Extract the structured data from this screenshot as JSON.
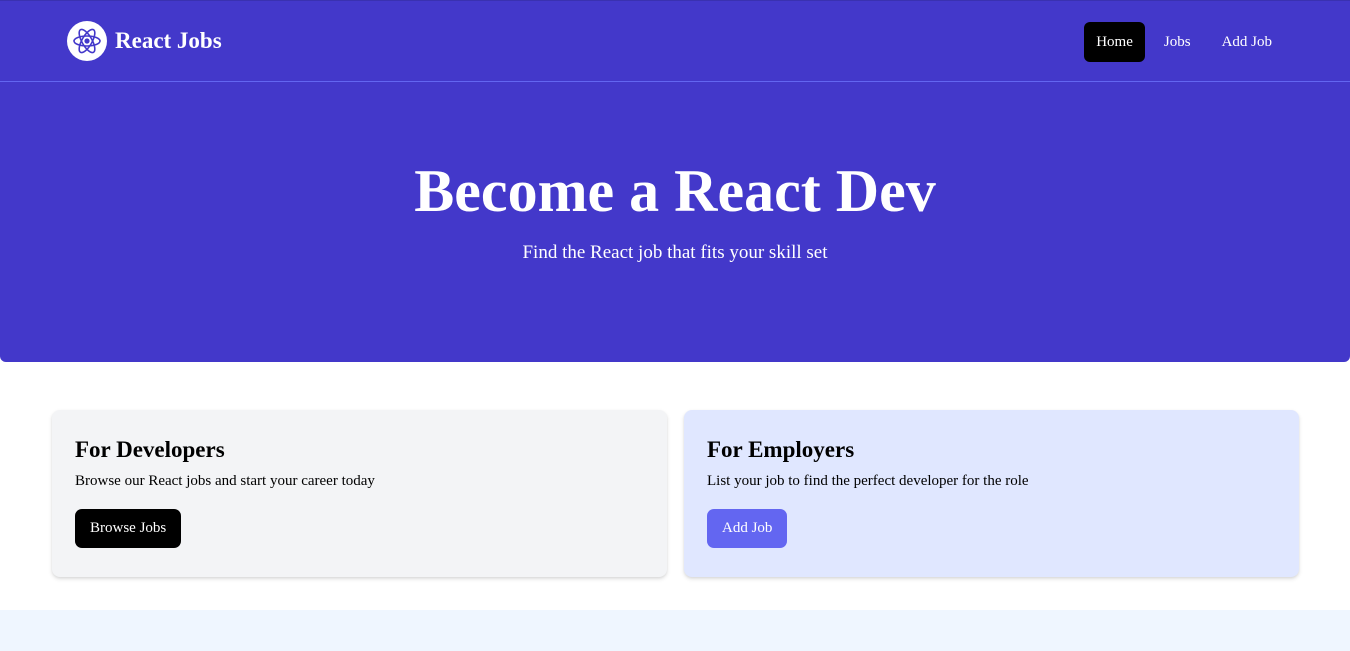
{
  "brand": {
    "name": "React Jobs",
    "logo_icon": "react-atom-icon"
  },
  "nav": {
    "items": [
      {
        "label": "Home",
        "active": true
      },
      {
        "label": "Jobs",
        "active": false
      },
      {
        "label": "Add Job",
        "active": false
      }
    ]
  },
  "hero": {
    "title": "Become a React Dev",
    "subtitle": "Find the React job that fits your skill set"
  },
  "cards": {
    "developers": {
      "title": "For Developers",
      "description": "Browse our React jobs and start your career today",
      "button_label": "Browse Jobs"
    },
    "employers": {
      "title": "For Employers",
      "description": "List your job to find the perfect developer for the role",
      "button_label": "Add Job"
    }
  },
  "colors": {
    "primary": "#4338ca",
    "button_dark": "#000000",
    "button_indigo": "#6366f1",
    "card_gray": "#f3f4f6",
    "card_indigo": "#e0e7ff",
    "bottom_band": "#eff6ff"
  }
}
